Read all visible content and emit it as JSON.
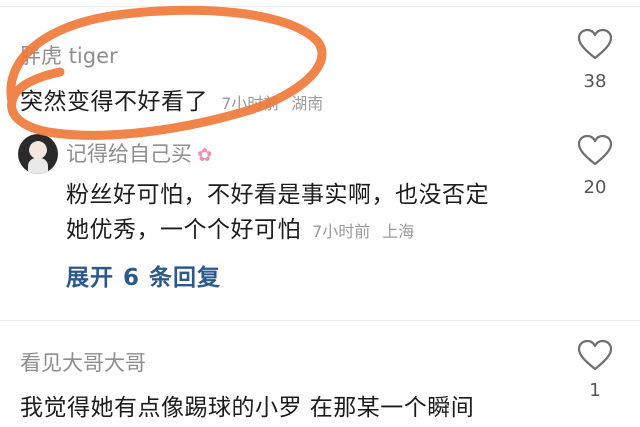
{
  "comments": [
    {
      "username": "胖虎 tiger",
      "text": "突然变得不好看了",
      "time": "7小时前",
      "location": "湖南",
      "likes": "38"
    },
    {
      "username": "记得给自己买",
      "badge_icon": "cherry-blossom-icon",
      "text_line1": "粉丝好可怕，不好看是事实啊，也没否定",
      "text_line2": "她优秀，一个个好可怕",
      "time": "7小时前",
      "location": "上海",
      "likes": "20",
      "expand_label": "展开 6 条回复"
    },
    {
      "username": "看见大哥大哥",
      "text": "我觉得她有点像踢球的小罗  在那某一个瞬间",
      "likes": "1"
    }
  ],
  "colors": {
    "scribble": "#f07a3a",
    "link": "#2b5a8a"
  }
}
